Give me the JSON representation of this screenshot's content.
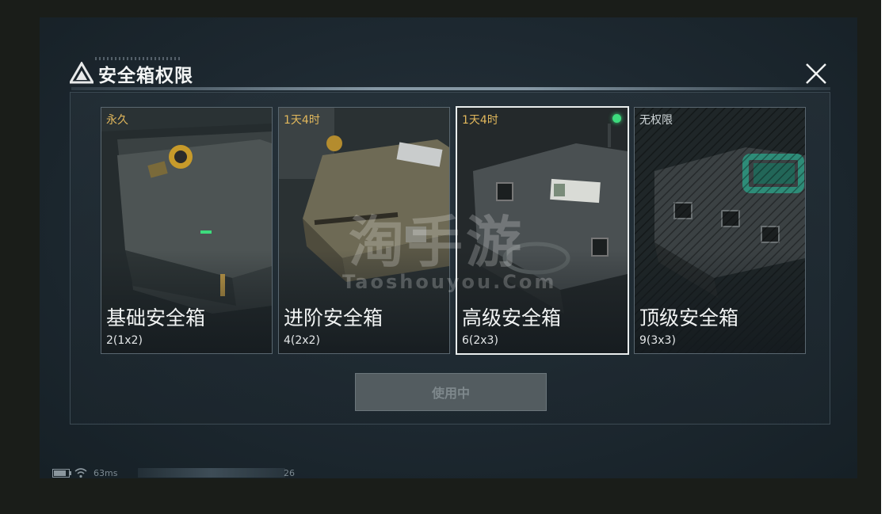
{
  "window": {
    "title": "安全箱权限"
  },
  "cards": [
    {
      "duration": "永久",
      "name": "基础安全箱",
      "capacity": "2(1x2)",
      "selected": false
    },
    {
      "duration": "1天4时",
      "name": "进阶安全箱",
      "capacity": "4(2x2)",
      "selected": false
    },
    {
      "duration": "1天4时",
      "name": "高级安全箱",
      "capacity": "6(2x3)",
      "selected": true
    },
    {
      "duration": "无权限",
      "name": "顶级安全箱",
      "capacity": "9(3x3)",
      "selected": false
    }
  ],
  "action": {
    "label": "使用中"
  },
  "watermark": {
    "main": "淘手游",
    "site": "Taoshouyou.Com"
  },
  "status_bar": {
    "ping": "63ms",
    "number": "26"
  },
  "colors": {
    "accent_gold": "#e2b85c",
    "active_dot": "#3ddc7d",
    "panel": "#1d2830"
  }
}
